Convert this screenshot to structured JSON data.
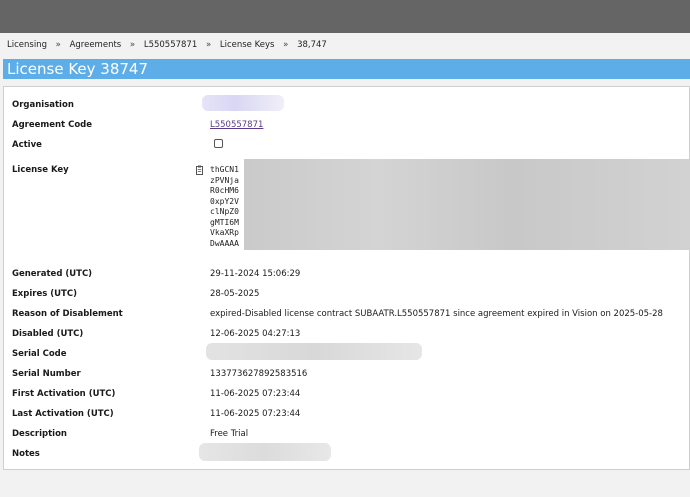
{
  "breadcrumb": [
    "Licensing",
    "Agreements",
    "L550557871",
    "License Keys",
    "38,747"
  ],
  "breadcrumb_separator": "»",
  "page_title": "License Key 38747",
  "fields": {
    "organisation": {
      "label": "Organisation",
      "value": ""
    },
    "agreement_code": {
      "label": "Agreement Code",
      "value": "L550557871"
    },
    "active": {
      "label": "Active",
      "checked": false
    },
    "license_key": {
      "label": "License Key",
      "lines": [
        "thGCN1",
        "zPVNja",
        "R0cHM6",
        "0xpY2V",
        "clNpZ0",
        "gMTI6M",
        "VkaXRp",
        "DwAAAA"
      ]
    },
    "generated": {
      "label": "Generated (UTC)",
      "value": "29-11-2024 15:06:29"
    },
    "expires": {
      "label": "Expires (UTC)",
      "value": "28-05-2025"
    },
    "reason": {
      "label": "Reason of Disablement",
      "value": "expired-Disabled license contract SUBAATR.L550557871 since agreement expired in Vision on 2025-05-28"
    },
    "disabled": {
      "label": "Disabled (UTC)",
      "value": "12-06-2025 04:27:13"
    },
    "serial_code": {
      "label": "Serial Code",
      "value": ""
    },
    "serial_number": {
      "label": "Serial Number",
      "value": "133773627892583516"
    },
    "first_activation": {
      "label": "First Activation (UTC)",
      "value": "11-06-2025 07:23:44"
    },
    "last_activation": {
      "label": "Last Activation (UTC)",
      "value": "11-06-2025 07:23:44"
    },
    "description": {
      "label": "Description",
      "value": "Free Trial"
    },
    "notes": {
      "label": "Notes",
      "value": ""
    }
  },
  "colors": {
    "title_bar": "#5daee8",
    "top_bar": "#656565",
    "link": "#5a3b8c",
    "redaction": "#d0d0d0"
  },
  "icons": {
    "copy": "clipboard-copy-icon"
  }
}
